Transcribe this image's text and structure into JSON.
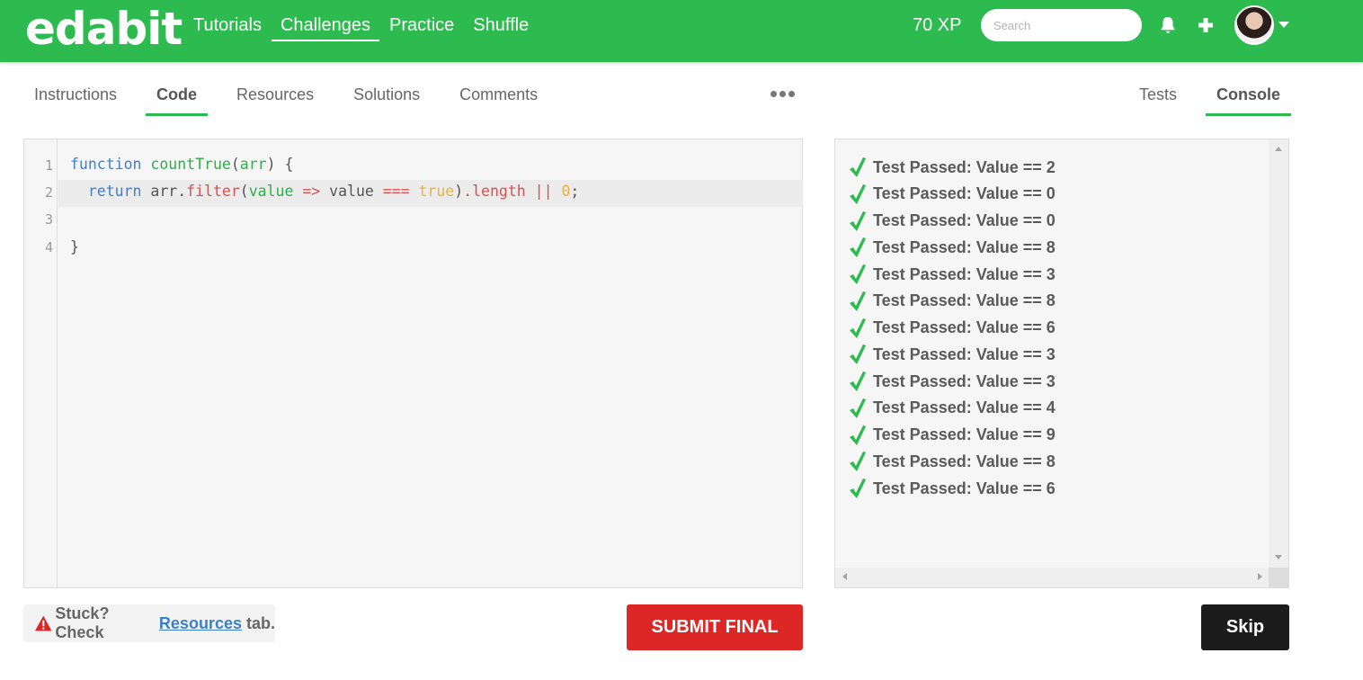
{
  "brand": {
    "logo": "edabit",
    "accent": "#2dba4e"
  },
  "nav": {
    "items": [
      {
        "label": "Tutorials",
        "active": false
      },
      {
        "label": "Challenges",
        "active": true
      },
      {
        "label": "Practice",
        "active": false
      },
      {
        "label": "Shuffle",
        "active": false
      }
    ],
    "xp": "70 XP",
    "search_placeholder": "Search",
    "icons": [
      "bell-icon",
      "plus-icon",
      "avatar",
      "caret-down-icon"
    ]
  },
  "left_tabs": [
    {
      "label": "Instructions",
      "active": false
    },
    {
      "label": "Code",
      "active": true
    },
    {
      "label": "Resources",
      "active": false
    },
    {
      "label": "Solutions",
      "active": false
    },
    {
      "label": "Comments",
      "active": false
    }
  ],
  "right_tabs": [
    {
      "label": "Tests",
      "active": false
    },
    {
      "label": "Console",
      "active": true
    }
  ],
  "editor": {
    "line_numbers": [
      "1",
      "2",
      "3",
      "4"
    ],
    "lines": {
      "l1": {
        "kw": "function",
        "name": "countTrue",
        "open": "(",
        "param": "arr",
        "close": ") {"
      },
      "l2": {
        "kw": "return",
        "obj": "arr.",
        "method": "filter",
        "p1": "(",
        "param": "value",
        "arrow": "=>",
        "sp": " value ",
        "op": "===",
        "lit": "true",
        "p2": ")",
        "prop": ".length",
        "or": "||",
        "zero": "0",
        "semi": ";"
      },
      "l3": "",
      "l4": "}"
    }
  },
  "console": {
    "status_color": "#2dba4e",
    "results": [
      "Test Passed: Value == 2",
      "Test Passed: Value == 0",
      "Test Passed: Value == 0",
      "Test Passed: Value == 8",
      "Test Passed: Value == 3",
      "Test Passed: Value == 8",
      "Test Passed: Value == 6",
      "Test Passed: Value == 3",
      "Test Passed: Value == 3",
      "Test Passed: Value == 4",
      "Test Passed: Value == 9",
      "Test Passed: Value == 8",
      "Test Passed: Value == 6"
    ]
  },
  "footer": {
    "stuck_prefix": "Stuck? Check",
    "stuck_link": "Resources",
    "stuck_suffix": "tab.",
    "submit_label": "SUBMIT FINAL",
    "skip_label": "Skip"
  }
}
